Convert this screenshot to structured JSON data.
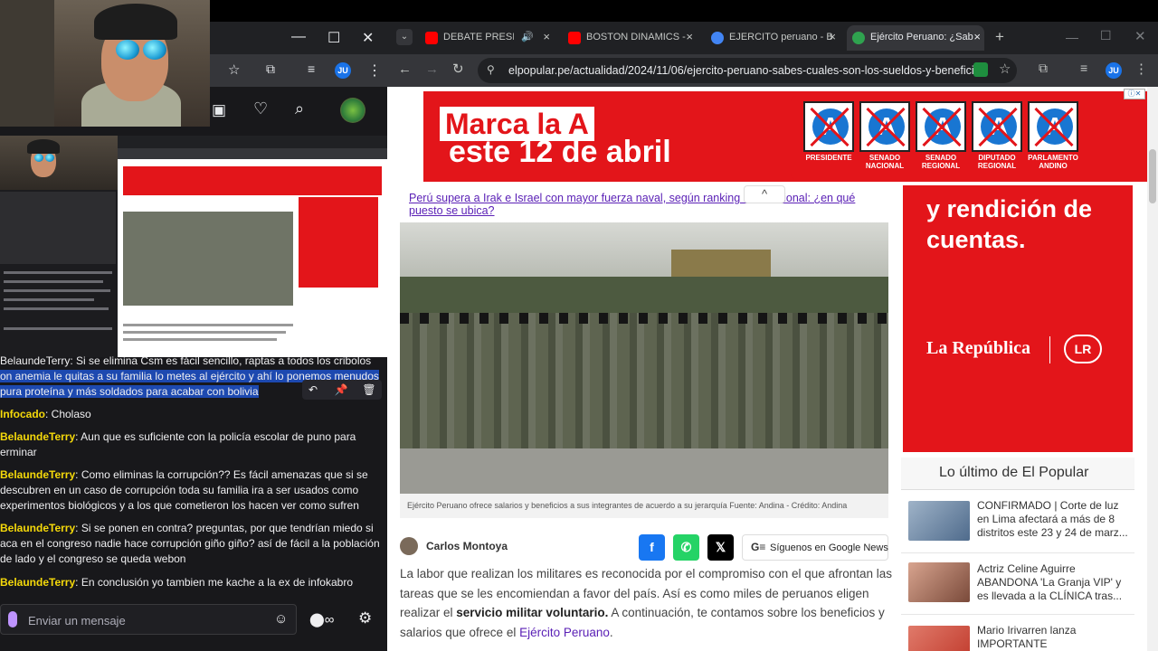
{
  "left_panel": {
    "browser_controls": {
      "minimize": "—",
      "maximize": "☐",
      "close": "✕"
    },
    "toolbar": {
      "avatar_initials": "JU"
    },
    "chat": {
      "messages": [
        {
          "user": "BelaundeTerry",
          "text": "Si se elimina Csm es fácil sencillo, raptas a todos los cribolos con anemia le quitas a su familia lo metes al ejército y ahí lo ponemos menudos pura proteína y más soldados para acabar con bolivia",
          "partial_first_line": "BelaundeTerry: Si se elimina Csm es fácil sencillo, raptas a todos los cribolos",
          "line2": "on anemia le quitas a su familia lo metes al ejército y ahí lo ponemos menudos",
          "line3": "pura proteína y más soldados para acabar con bolivia"
        },
        {
          "user": "Infocado",
          "text": "Cholaso"
        },
        {
          "user": "BelaundeTerry",
          "text": "Aun que es suficiente con la policía escolar de puno para",
          "line2": "erminar"
        },
        {
          "user": "BelaundeTerry",
          "text": "Como eliminas la corrupción?? Es fácil amenazas que si se",
          "line2": "descubren en un caso de corrupción toda su familia ira a ser usados como",
          "line3": "experimentos biológicos y a los que cometieron los hacen ver como sufren"
        },
        {
          "user": "BelaundeTerry",
          "text": "Si se ponen en contra? preguntas, por que tendrían miedo si",
          "line2": "aca en el congreso nadie hace corrupción giño giño? así de fácil a la población",
          "line3": "de lado y el congreso se queda webon"
        },
        {
          "user": "BelaundeTerry",
          "text": "En conclusión yo tambien me kache a la ex de infokabro"
        }
      ],
      "input_placeholder": "Enviar un mensaje"
    }
  },
  "browser": {
    "tabs": [
      {
        "title": "DEBATE PRESIDENCIAL",
        "favicon_color": "#ff0000"
      },
      {
        "title": "BOSTON DINAMICS - ",
        "favicon_color": "#ff0000"
      },
      {
        "title": "EJERCITO peruano - B",
        "favicon_color": "#4285f4"
      },
      {
        "title": "Ejército Peruano: ¿Sab",
        "favicon_color": "#2fa24f",
        "active": true
      }
    ],
    "new_tab": "+",
    "url": "elpopular.pe/actualidad/2024/11/06/ejercito-peruano-sabes-cuales-son-los-sueldos-y-benefici...",
    "avatar_initials": "JU"
  },
  "page": {
    "banner": {
      "line1": "Marca la A",
      "line2": "este 12 de abril",
      "ballot_letter": "A",
      "ballot_labels": [
        "PRESIDENTE",
        "SENADO NACIONAL",
        "SENADO REGIONAL",
        "DIPUTADO REGIONAL",
        "PARLAMENTO ANDINO"
      ]
    },
    "related_link": "Perú supera a Irak e Israel con mayor fuerza naval, según ranking internacional: ¿en qué puesto se ubica?",
    "collapse_icon": "^",
    "photo_caption": "Ejército Peruano ofrece salarios y beneficios a sus integrantes de acuerdo a su jerarquía Fuente: Andina - Crédito: Andina",
    "author": "Carlos Montoya",
    "share": {
      "facebook": "f",
      "whatsapp": "✆",
      "x": "𝕏"
    },
    "google_news": "Síguenos en Google News",
    "body_p1": "La labor que realizan los militares es reconocida por el compromiso con el que afrontan las tareas que se les encomiendan a favor del país. Así es como miles de peruanos eligen realizar el ",
    "body_bold": "servicio militar voluntario.",
    "body_p2": " A continuación, te contamos sobre los beneficios y salarios que ofrece el ",
    "body_link": "Ejército Peruano",
    "body_end": ".",
    "ad": {
      "text": "y rendición de cuentas.",
      "logo": "La República",
      "lr": "LR"
    },
    "latest": {
      "title": "Lo último de El Popular",
      "items": [
        {
          "text": "CONFIRMADO | Corte de luz en Lima afectará a más de 8 distritos este 23 y 24 de marz...",
          "thumb_color": "#4f6b8c"
        },
        {
          "text": "Actriz Celine Aguirre ABANDONA 'La Granja VIP' y es llevada a la CLÍNICA tras...",
          "thumb_color": "#b37a6a"
        },
        {
          "text": "Mario Irivarren lanza IMPORTANTE COMUNICADO...",
          "thumb_color": "#c0392b"
        }
      ]
    }
  },
  "colors": {
    "banner_red": "#e3151a",
    "link_purple": "#5b21b6",
    "chat_username": "#f5d90a",
    "chat_highlight": "#1d49b0",
    "facebook": "#1877f2",
    "whatsapp": "#25d366",
    "x": "#000000"
  }
}
